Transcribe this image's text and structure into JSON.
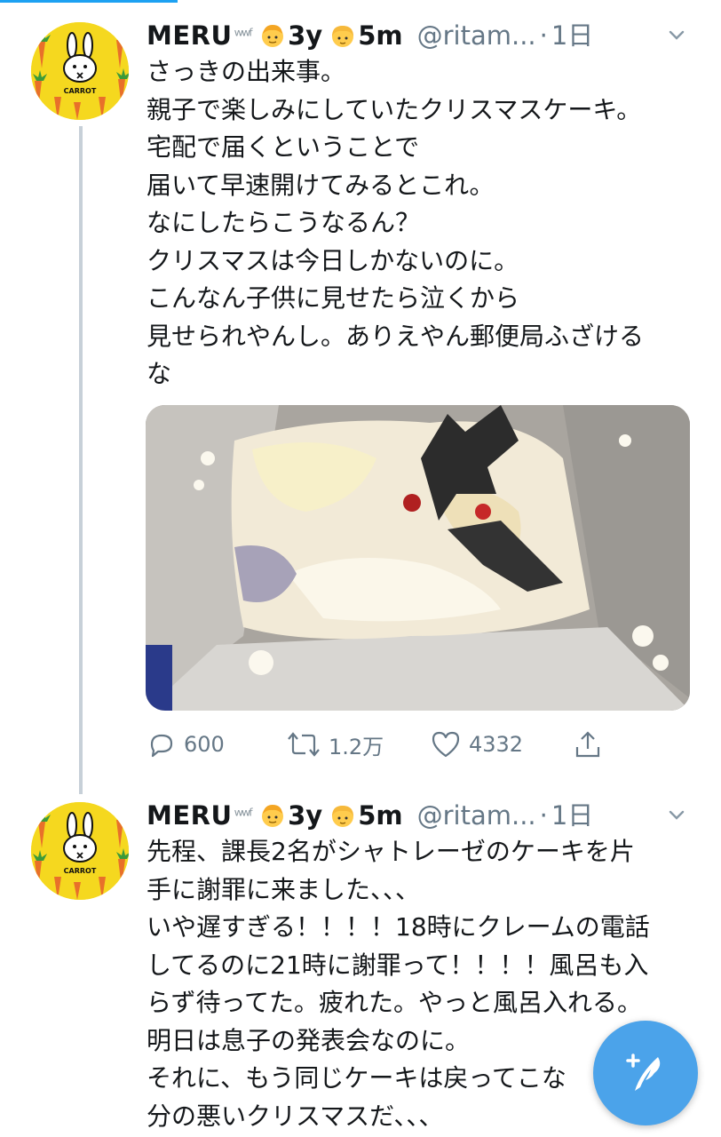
{
  "tweets": [
    {
      "display_name": "MERU",
      "name_deco": "ʷʷᶠ",
      "child1_age": "3y",
      "child2_age": "5m",
      "handle": "@ritam...",
      "separator": "·",
      "time": "1日",
      "menu_icon": "chevron-down-icon",
      "text": "さっきの出来事。\n親子で楽しみにしていたクリスマスケーキ。\n宅配で届くということで\n届いて早速開けてみるとこれ。\nなにしたらこうなるん？\nクリスマスは今日しかないのに。\nこんなん子供に見せたら泣くから\n見せられやんし。ありえやん郵便局ふざける\nな",
      "stats": {
        "replies": "600",
        "retweets": "1.2万",
        "likes": "4332"
      }
    },
    {
      "display_name": "MERU",
      "name_deco": "ʷʷᶠ",
      "child1_age": "3y",
      "child2_age": "5m",
      "handle": "@ritam...",
      "separator": "·",
      "time": "1日",
      "menu_icon": "chevron-down-icon",
      "text": "先程、課長2名がシャトレーゼのケーキを片\n手に謝罪に来ました、、、\nいや遅すぎる！！！！18時にクレームの電話\nしてるのに21時に謝罪って！！！！風呂も入\nらず待ってた。疲れた。やっと風呂入れる。\n明日は息子の発表会なのに。\nそれに、もう同じケーキは戻ってこな\n分の悪いクリスマスだ、、、"
    }
  ],
  "avatar_badge": "CARROT",
  "icons": {
    "reply": "reply-icon",
    "retweet": "retweet-icon",
    "like": "heart-icon",
    "share": "share-icon",
    "compose": "compose-tweet-icon"
  },
  "colors": {
    "accent": "#1da1f2",
    "fab": "#4ba3ea",
    "muted": "#657786",
    "thread_line": "#c7d0d8"
  }
}
